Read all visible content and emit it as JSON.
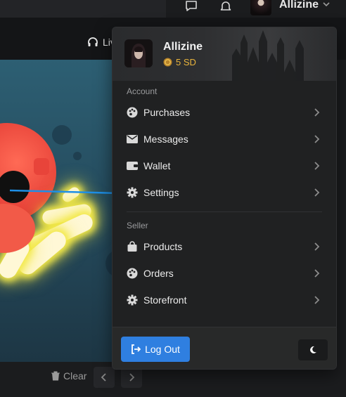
{
  "header": {
    "username": "Allizine",
    "icons": [
      "chat-icon",
      "bell-icon",
      "chevron-down-icon"
    ]
  },
  "subbar": {
    "live_label": "Liv"
  },
  "dropdown": {
    "user": {
      "name": "Allizine",
      "balance": "5 SD"
    },
    "sections": [
      {
        "label": "Account",
        "items": [
          {
            "label": "Purchases",
            "icon": "palette-icon"
          },
          {
            "label": "Messages",
            "icon": "envelope-icon"
          },
          {
            "label": "Wallet",
            "icon": "wallet-icon"
          },
          {
            "label": "Settings",
            "icon": "gear-icon"
          }
        ]
      },
      {
        "label": "Seller",
        "items": [
          {
            "label": "Products",
            "icon": "shopping-bag-icon"
          },
          {
            "label": "Orders",
            "icon": "palette-icon"
          },
          {
            "label": "Storefront",
            "icon": "gear-icon"
          }
        ]
      }
    ],
    "footer": {
      "logout_label": "Log Out",
      "theme_icon": "moon-icon"
    }
  },
  "bottom": {
    "clear_label": "Clear"
  },
  "colors": {
    "accent": "#2f7fe0",
    "coin": "#e9b43c",
    "arrow": "#1e8fe6"
  }
}
